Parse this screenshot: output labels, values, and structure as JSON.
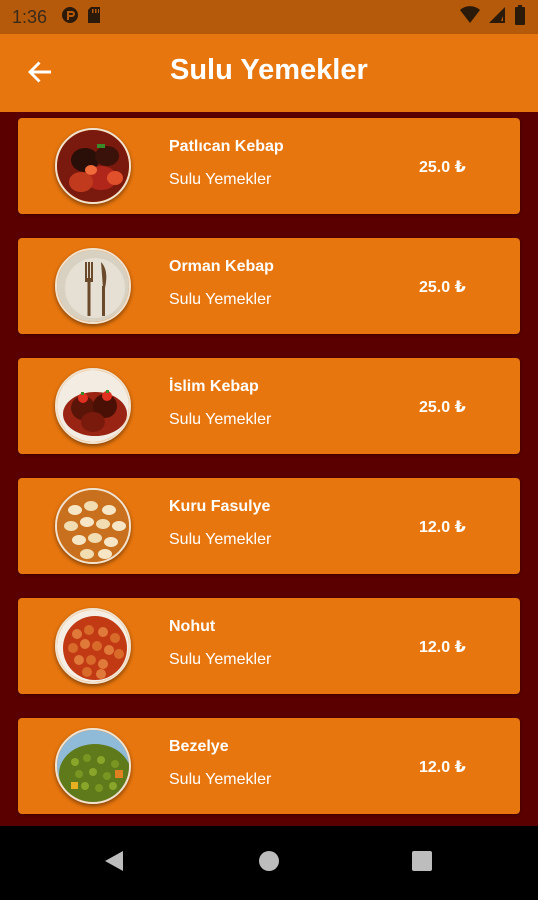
{
  "status_bar": {
    "time": "1:36",
    "icons": [
      "signal-app-icon",
      "sd-card-icon",
      "wifi-icon",
      "cell-signal-icon",
      "battery-icon"
    ]
  },
  "app_bar": {
    "back_icon": "arrow-back-icon",
    "title": "Sulu Yemekler"
  },
  "menu_items": [
    {
      "name": "Patlıcan Kebap",
      "category": "Sulu Yemekler",
      "price": "25.0 ₺",
      "image": "eggplant-kebab"
    },
    {
      "name": "Orman Kebap",
      "category": "Sulu Yemekler",
      "price": "25.0 ₺",
      "image": "fork-knife-placeholder"
    },
    {
      "name": "İslim Kebap",
      "category": "Sulu Yemekler",
      "price": "25.0 ₺",
      "image": "islim-kebab"
    },
    {
      "name": "Kuru Fasulye",
      "category": "Sulu Yemekler",
      "price": "12.0 ₺",
      "image": "white-beans"
    },
    {
      "name": "Nohut",
      "category": "Sulu Yemekler",
      "price": "12.0 ₺",
      "image": "chickpeas"
    },
    {
      "name": "Bezelye",
      "category": "Sulu Yemekler",
      "price": "12.0 ₺",
      "image": "peas"
    }
  ],
  "nav_bar": {
    "back": "triangle-back-icon",
    "home": "circle-home-icon",
    "recents": "square-recents-icon"
  },
  "colors": {
    "status_bar": "#b45a0a",
    "app_bar": "#e8760e",
    "card": "#e8760e",
    "list_background": "#5a0000",
    "text": "#ffffff"
  }
}
